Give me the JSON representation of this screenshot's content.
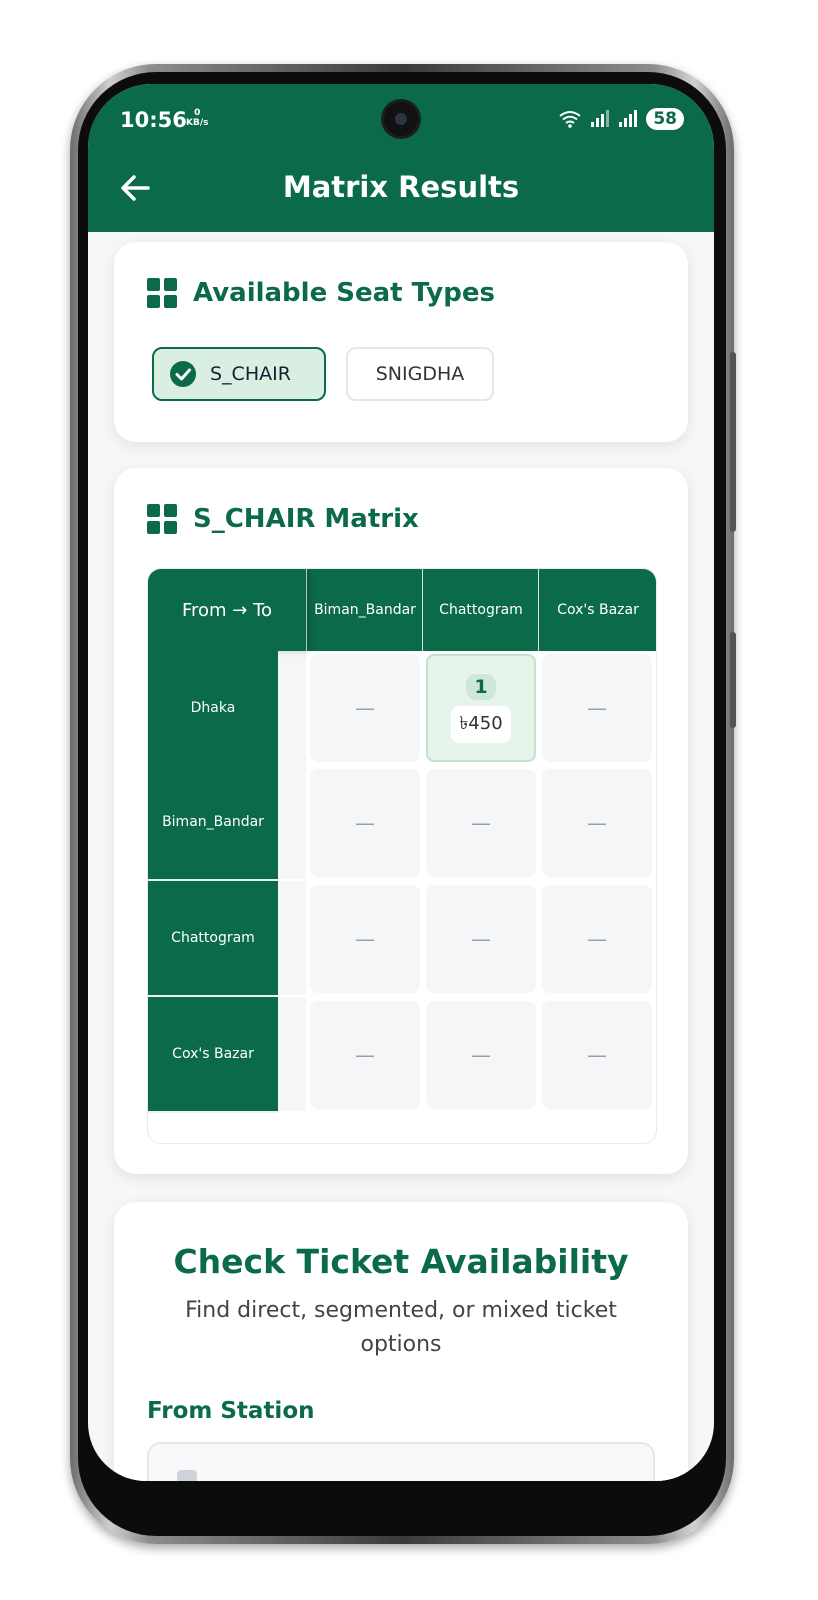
{
  "status_bar": {
    "time": "10:56",
    "net_speed_value": "0",
    "net_speed_unit": "KB/s",
    "battery": "58"
  },
  "header": {
    "title": "Matrix Results",
    "back_icon": "arrow-left-icon"
  },
  "seat_types": {
    "title": "Available Seat Types",
    "options": [
      {
        "label": "S_CHAIR",
        "selected": true
      },
      {
        "label": "SNIGDHA",
        "selected": false
      }
    ]
  },
  "matrix": {
    "title": "S_CHAIR Matrix",
    "corner_label": "From → To",
    "columns": [
      "Biman_Bandar",
      "Chattogram",
      "Cox's Bazar"
    ],
    "rows": [
      {
        "from": "Dhaka",
        "cells": [
          "—",
          {
            "count": "1",
            "price": "৳450"
          },
          "—"
        ]
      },
      {
        "from": "Biman_Bandar",
        "cells": [
          "—",
          "—",
          "—"
        ]
      },
      {
        "from": "Chattogram",
        "cells": [
          "—",
          "—",
          "—"
        ]
      },
      {
        "from": "Cox's Bazar",
        "cells": [
          "—",
          "—",
          "—"
        ]
      }
    ]
  },
  "availability": {
    "title": "Check Ticket Availability",
    "subtitle": "Find direct, segmented, or mixed ticket options",
    "from_label": "From Station"
  },
  "colors": {
    "primary": "#0b6b48",
    "selected_chip_bg": "#d8efe2",
    "active_cell_bg": "#e7f4ec"
  }
}
